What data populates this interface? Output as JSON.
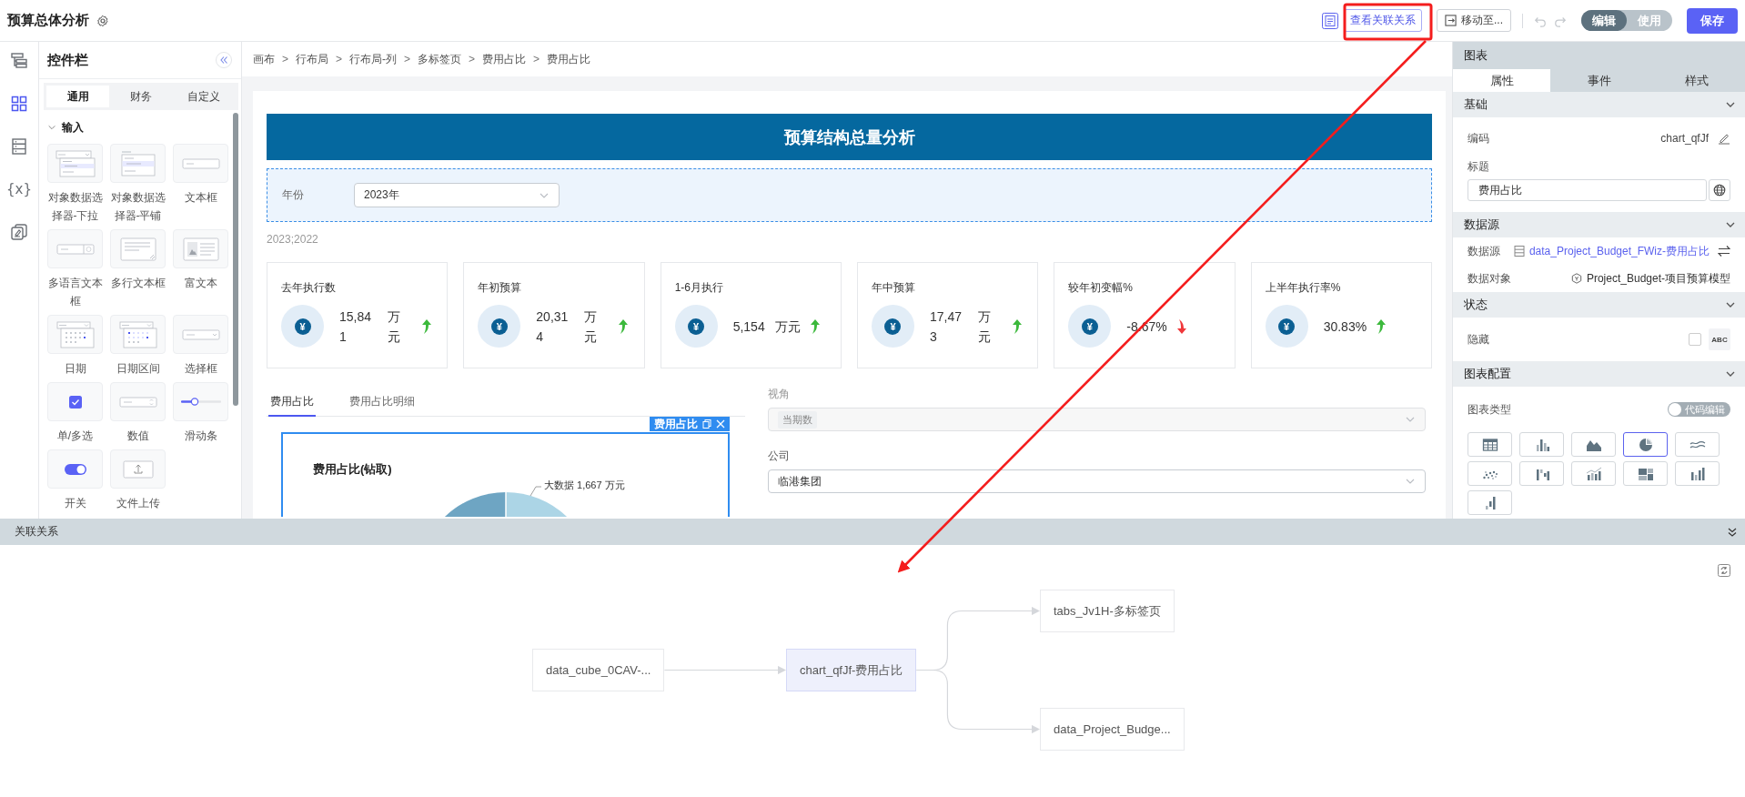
{
  "toolbar": {
    "title": "预算总体分析",
    "buttons": [
      {
        "kind": "relations",
        "label": "查看关联关系"
      },
      {
        "kind": "move",
        "label": "移动至..."
      }
    ],
    "history": [
      {
        "kind": "undo",
        "disabled": true
      },
      {
        "kind": "redo",
        "disabled": true
      }
    ],
    "mode": [
      {
        "label": "编辑",
        "selected": true
      },
      {
        "label": "使用",
        "selected": false
      }
    ],
    "save": "保存"
  },
  "rail": [
    {
      "kind": "outline",
      "selected": false
    },
    {
      "kind": "widgets",
      "selected": true
    },
    {
      "kind": "data",
      "selected": false
    },
    {
      "kind": "variables",
      "label": "{x}",
      "selected": false
    },
    {
      "kind": "pages",
      "selected": false
    }
  ],
  "widget_panel": {
    "title": "控件栏",
    "tabs": [
      {
        "label": "通用",
        "selected": true
      },
      {
        "label": "财务",
        "selected": false
      },
      {
        "label": "自定义",
        "selected": false
      }
    ],
    "group": {
      "label": "输入",
      "expanded": true
    },
    "items": [
      {
        "kind": "dropdown-picker",
        "label": "对象数据选择器-下拉"
      },
      {
        "kind": "tiled-picker",
        "label": "对象数据选择器-平铺"
      },
      {
        "kind": "textbox",
        "label": "文本框"
      },
      {
        "kind": "multilang",
        "label": "多语言文本框"
      },
      {
        "kind": "textarea",
        "label": "多行文本框"
      },
      {
        "kind": "richtext",
        "label": "富文本"
      },
      {
        "kind": "date",
        "label": "日期"
      },
      {
        "kind": "daterange",
        "label": "日期区间"
      },
      {
        "kind": "select",
        "label": "选择框"
      },
      {
        "kind": "checkbox",
        "label": "单/多选"
      },
      {
        "kind": "number",
        "label": "数值"
      },
      {
        "kind": "slider",
        "label": "滑动条"
      },
      {
        "kind": "switch",
        "label": "开关"
      },
      {
        "kind": "upload",
        "label": "文件上传"
      }
    ]
  },
  "breadcrumb": [
    {
      "label": "画布"
    },
    {
      "separator": ">",
      "label": "行布局"
    },
    {
      "separator": ">",
      "label": "行布局-列"
    },
    {
      "separator": ">",
      "label": "多标签页"
    },
    {
      "separator": ">",
      "label": "费用占比"
    },
    {
      "separator": ">",
      "label": "费用占比"
    }
  ],
  "report": {
    "banner": "预算结构总量分析",
    "filter": {
      "label": "年份",
      "value": "2023年"
    },
    "filter_summary": "2023;2022",
    "kpis": [
      {
        "title": "去年执行数",
        "symbol": "¥",
        "value": "15,841",
        "unit": "万元",
        "rising": true
      },
      {
        "title": "年初预算",
        "symbol": "¥",
        "value": "20,314",
        "unit": "万元",
        "rising": true
      },
      {
        "title": "1-6月执行",
        "symbol": "¥",
        "value": "5,154",
        "unit": "万元",
        "rising": true
      },
      {
        "title": "年中预算",
        "symbol": "¥",
        "value": "17,473",
        "unit": "万元",
        "rising": true
      },
      {
        "title": "较年初变幅%",
        "symbol": "¥",
        "value": "-8.67%",
        "rising": false
      },
      {
        "title": "上半年执行率%",
        "symbol": "¥",
        "value": "30.83%",
        "rising": true
      }
    ],
    "tabs": [
      {
        "label": "费用占比",
        "selected": true
      },
      {
        "label": "费用占比明细",
        "selected": false
      }
    ],
    "selection_badge": "费用占比",
    "chart": {
      "title": "费用占比(钻取)",
      "slice_label": "大数据 1,667 万元"
    },
    "side_filters": [
      {
        "label": "视角",
        "tag": "当期数",
        "disabled": true
      },
      {
        "label": "公司",
        "value": "临港集团",
        "disabled": false
      }
    ]
  },
  "properties": {
    "title": "图表",
    "tabs": [
      {
        "label": "属性",
        "selected": true
      },
      {
        "label": "事件",
        "selected": false
      },
      {
        "label": "样式",
        "selected": false
      }
    ],
    "basic": {
      "heading": "基础",
      "code_label": "编码",
      "code": "chart_qfJf",
      "title_label": "标题",
      "title_value": "费用占比"
    },
    "datasource": {
      "heading": "数据源",
      "source_label": "数据源",
      "source": "data_Project_Budget_FWiz-费用占比",
      "object_label": "数据对象",
      "object": "Project_Budget-项目预算模型"
    },
    "state": {
      "heading": "状态",
      "hidden_label": "隐藏",
      "hidden": false,
      "format_button": "ABC"
    },
    "chart_config": {
      "heading": "图表配置",
      "type_label": "图表类型",
      "code_edit": {
        "label": "代码编辑",
        "on": false
      },
      "chart_types": [
        {
          "kind": "table",
          "selected": false
        },
        {
          "kind": "bar",
          "selected": false
        },
        {
          "kind": "area",
          "selected": false
        },
        {
          "kind": "pie",
          "selected": true
        },
        {
          "kind": "line",
          "selected": false
        },
        {
          "kind": "scatter",
          "selected": false
        },
        {
          "kind": "waterfall",
          "selected": false
        },
        {
          "kind": "combo",
          "selected": false
        },
        {
          "kind": "treemap",
          "selected": false
        },
        {
          "kind": "column",
          "selected": false
        },
        {
          "kind": "step",
          "selected": false
        }
      ]
    }
  },
  "relations": {
    "title": "关联关系",
    "tree": {
      "label": "data_cube_0CAV-...",
      "selected": false,
      "children": [
        {
          "label": "chart_qfJf-费用占比",
          "selected": true,
          "children": [
            {
              "label": "tabs_Jv1H-多标签页",
              "selected": false
            },
            {
              "label": "data_Project_Budge...",
              "selected": false
            }
          ]
        }
      ]
    }
  }
}
